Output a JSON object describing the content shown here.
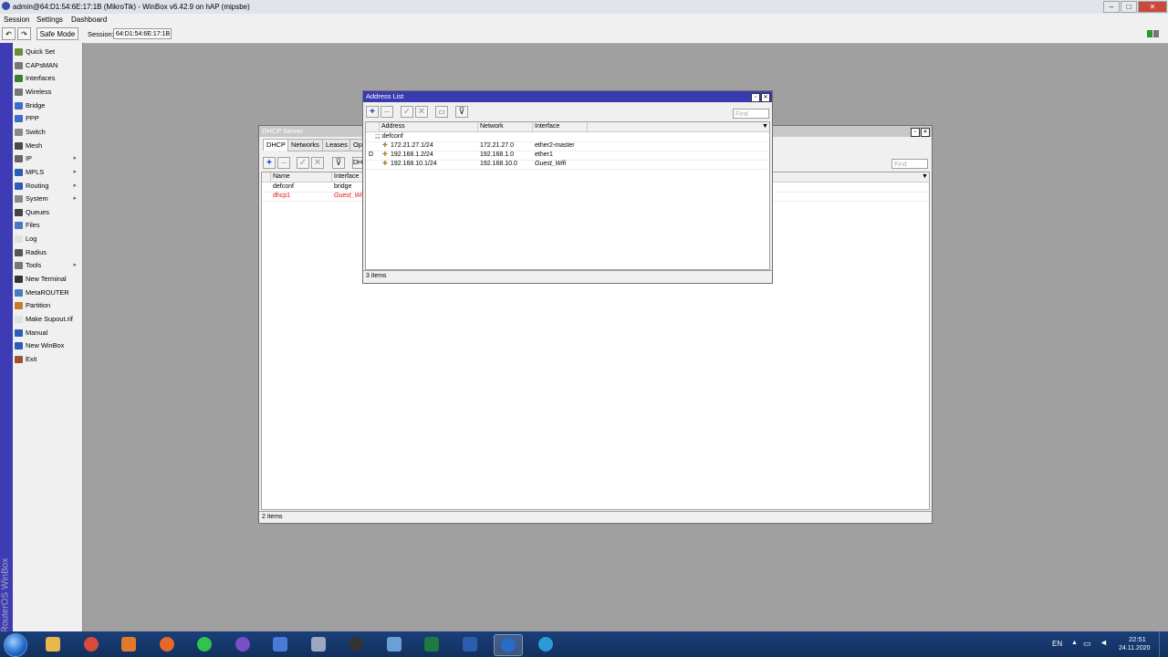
{
  "window": {
    "title": "admin@64:D1:54:6E:17:1B (MikroTik) - WinBox v6.42.9 on hAP (mipsbe)",
    "min": "–",
    "max": "□",
    "close": "✕"
  },
  "menubar": {
    "items": [
      "Session",
      "Settings",
      "Dashboard"
    ]
  },
  "toolbar": {
    "undo": "↶",
    "redo": "↷",
    "safe_mode": "Safe Mode",
    "session_label": "Session:",
    "session_value": "64:D1:54:6E:17:1B"
  },
  "branding": {
    "vertical_text": "RouterOS WinBox"
  },
  "sidebar": {
    "items": [
      {
        "label": "Quick Set",
        "icon": "quickset-icon",
        "color": "#6a8f3a",
        "submenu": false
      },
      {
        "label": "CAPsMAN",
        "icon": "capsman-icon",
        "color": "#777777",
        "submenu": false
      },
      {
        "label": "Interfaces",
        "icon": "interfaces-icon",
        "color": "#3a7d3a",
        "submenu": false
      },
      {
        "label": "Wireless",
        "icon": "wireless-icon",
        "color": "#777777",
        "submenu": false
      },
      {
        "label": "Bridge",
        "icon": "bridge-icon",
        "color": "#3a6ec9",
        "submenu": false
      },
      {
        "label": "PPP",
        "icon": "ppp-icon",
        "color": "#3a6ec9",
        "submenu": false
      },
      {
        "label": "Switch",
        "icon": "switch-icon",
        "color": "#8a8a8a",
        "submenu": false
      },
      {
        "label": "Mesh",
        "icon": "mesh-icon",
        "color": "#4a4a4a",
        "submenu": false
      },
      {
        "label": "IP",
        "icon": "ip-icon",
        "color": "#666666",
        "submenu": true
      },
      {
        "label": "MPLS",
        "icon": "mpls-icon",
        "color": "#2b5cb8",
        "submenu": true
      },
      {
        "label": "Routing",
        "icon": "routing-icon",
        "color": "#2b5cb8",
        "submenu": true
      },
      {
        "label": "System",
        "icon": "system-icon",
        "color": "#888888",
        "submenu": true
      },
      {
        "label": "Queues",
        "icon": "queues-icon",
        "color": "#444444",
        "submenu": false
      },
      {
        "label": "Files",
        "icon": "files-icon",
        "color": "#4a78c9",
        "submenu": false
      },
      {
        "label": "Log",
        "icon": "log-icon",
        "color": "#e0e0e0",
        "submenu": false
      },
      {
        "label": "Radius",
        "icon": "radius-icon",
        "color": "#555555",
        "submenu": false
      },
      {
        "label": "Tools",
        "icon": "tools-icon",
        "color": "#777777",
        "submenu": true
      },
      {
        "label": "New Terminal",
        "icon": "terminal-icon",
        "color": "#333333",
        "submenu": false
      },
      {
        "label": "MetaROUTER",
        "icon": "metarouter-icon",
        "color": "#4a78c9",
        "submenu": false
      },
      {
        "label": "Partition",
        "icon": "partition-icon",
        "color": "#c97a2b",
        "submenu": false
      },
      {
        "label": "Make Supout.rif",
        "icon": "supout-icon",
        "color": "#e0e0e0",
        "submenu": false
      },
      {
        "label": "Manual",
        "icon": "manual-icon",
        "color": "#2b5cb8",
        "submenu": false
      },
      {
        "label": "New WinBox",
        "icon": "winbox-icon",
        "color": "#2b5cb8",
        "submenu": false
      },
      {
        "label": "Exit",
        "icon": "exit-icon",
        "color": "#a0522d",
        "submenu": false
      }
    ]
  },
  "dhcp_window": {
    "title": "DHCP Server",
    "tabs": [
      "DHCP",
      "Networks",
      "Leases",
      "Opt"
    ],
    "extra_btn": "DH",
    "find_placeholder": "Find",
    "columns": [
      "Name",
      "Interface"
    ],
    "rows": [
      {
        "name": "defconf",
        "interface": "bridge",
        "disabled": false
      },
      {
        "name": "dhcp1",
        "interface": "Guest_Wifi",
        "disabled": true
      }
    ],
    "status": "2 items",
    "disabled_color": "#e01010"
  },
  "address_window": {
    "title": "Address List",
    "find_placeholder": "Find",
    "columns": [
      "Address",
      "Network",
      "Interface"
    ],
    "comment": ";;; defconf",
    "rows": [
      {
        "flag": "",
        "address": "172.21.27.1/24",
        "network": "172.21.27.0",
        "interface": "ether2-master",
        "italic": false
      },
      {
        "flag": "D",
        "address": "192.168.1.2/24",
        "network": "192.168.1.0",
        "interface": "ether1",
        "italic": false
      },
      {
        "flag": "",
        "address": "192.168.10.1/24",
        "network": "192.168.10.0",
        "interface": "Guest_Wifi",
        "italic": true
      }
    ],
    "status": "3 items",
    "title_color": "#3a3ab0"
  },
  "taskbar": {
    "apps": [
      {
        "name": "explorer",
        "color": "#e8b84a"
      },
      {
        "name": "chrome",
        "color": "#d94a3a"
      },
      {
        "name": "media-player",
        "color": "#e07a2a"
      },
      {
        "name": "firefox",
        "color": "#e8682a"
      },
      {
        "name": "whatsapp",
        "color": "#2ec44e"
      },
      {
        "name": "viber",
        "color": "#7a4ec9"
      },
      {
        "name": "network-app",
        "color": "#4a7ad8"
      },
      {
        "name": "calculator",
        "color": "#9aa8c0"
      },
      {
        "name": "lock-app",
        "color": "#333333"
      },
      {
        "name": "notepad",
        "color": "#6aa0d8"
      },
      {
        "name": "excel",
        "color": "#1e7a40"
      },
      {
        "name": "word",
        "color": "#2a5cb0"
      },
      {
        "name": "winbox",
        "color": "#2a6ac9"
      },
      {
        "name": "telegram",
        "color": "#2a9ad8"
      }
    ],
    "lang": "EN",
    "time": "22:51",
    "date": "24.11.2020"
  }
}
